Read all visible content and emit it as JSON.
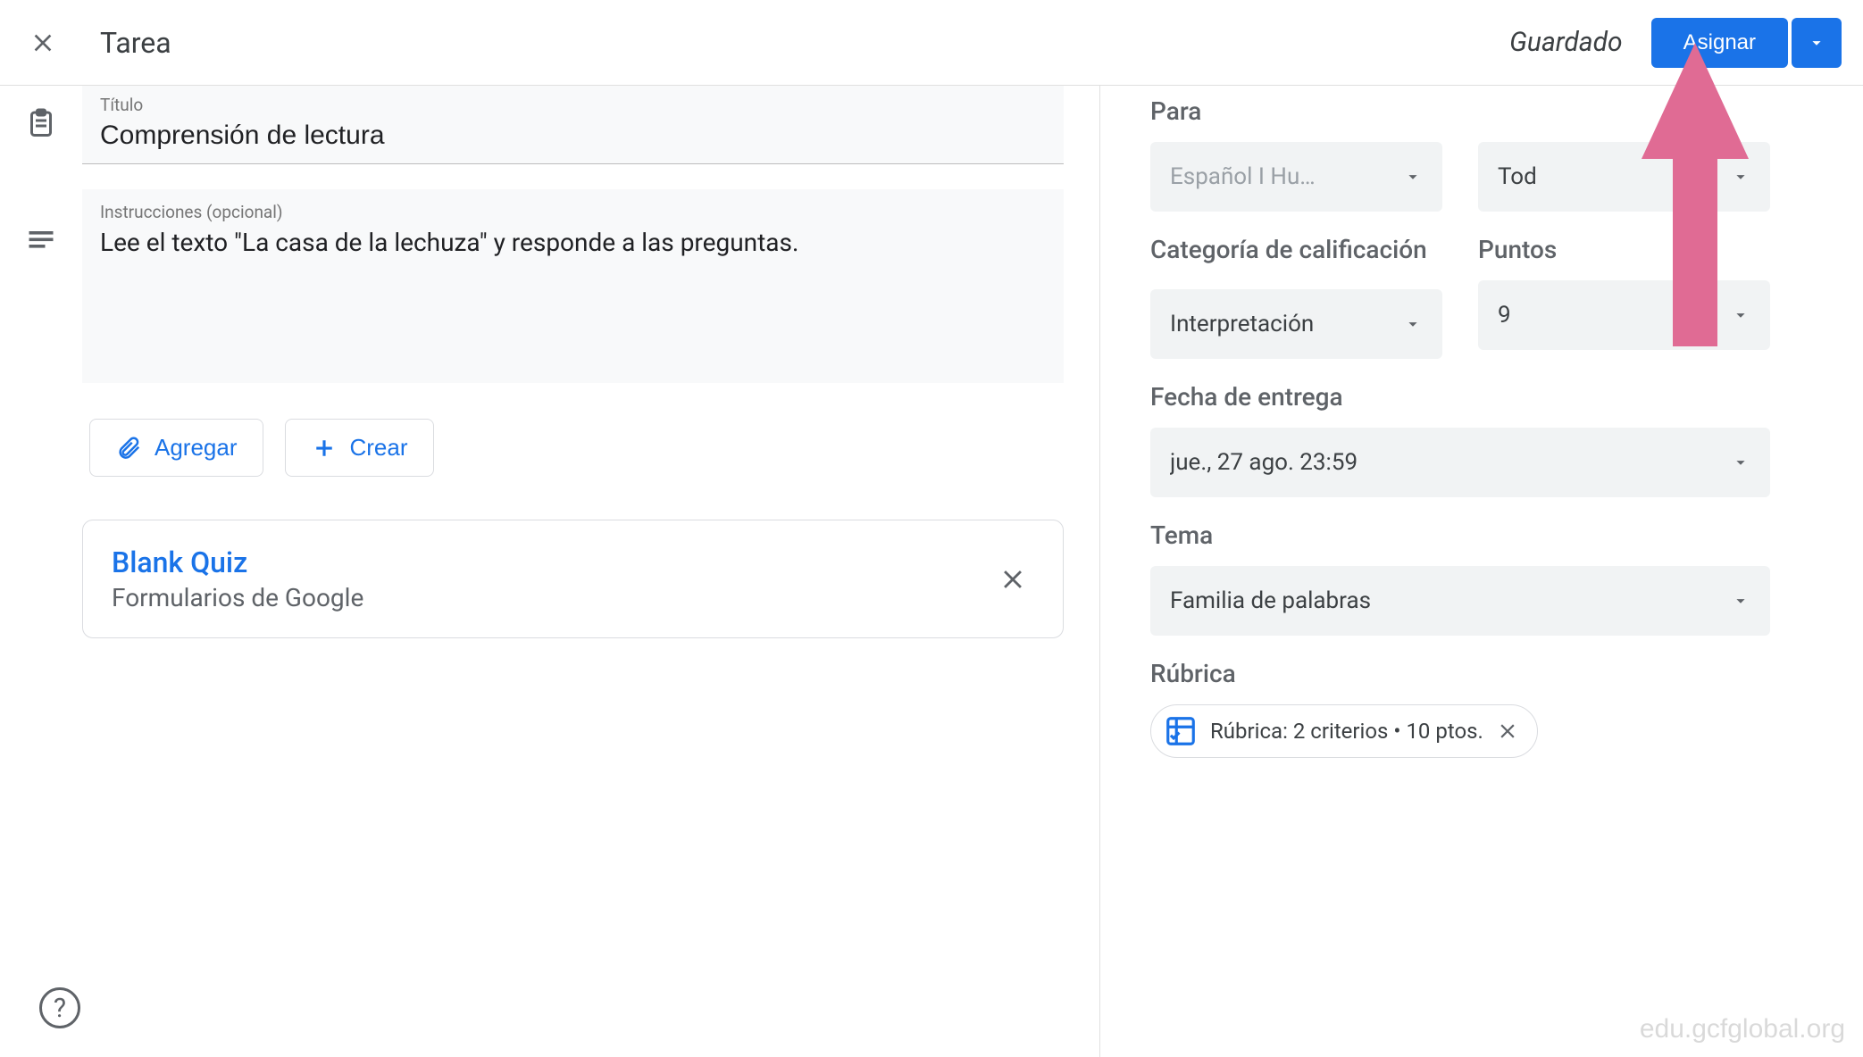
{
  "header": {
    "page_type": "Tarea",
    "saved_label": "Guardado",
    "assign_label": "Asignar"
  },
  "main": {
    "title_label": "Título",
    "title_value": "Comprensión de lectura",
    "instructions_label": "Instrucciones (opcional)",
    "instructions_value": "Lee el texto \"La casa de la lechuza\" y responde a las preguntas.",
    "add_button": "Agregar",
    "create_button": "Crear",
    "attachment": {
      "title": "Blank Quiz",
      "subtitle": "Formularios de Google"
    }
  },
  "side": {
    "for_label": "Para",
    "class_value": "Español I Hu…",
    "students_value": "Tod",
    "grade_category_label": "Categoría de calificación",
    "grade_category_value": "Interpretación",
    "points_label": "Puntos",
    "points_value": "9",
    "due_label": "Fecha de entrega",
    "due_value": "jue., 27 ago. 23:59",
    "topic_label": "Tema",
    "topic_value": "Familia de palabras",
    "rubric_label": "Rúbrica",
    "rubric_chip": "Rúbrica: 2 criterios • 10 ptos."
  },
  "watermark": "edu.gcfglobal.org"
}
